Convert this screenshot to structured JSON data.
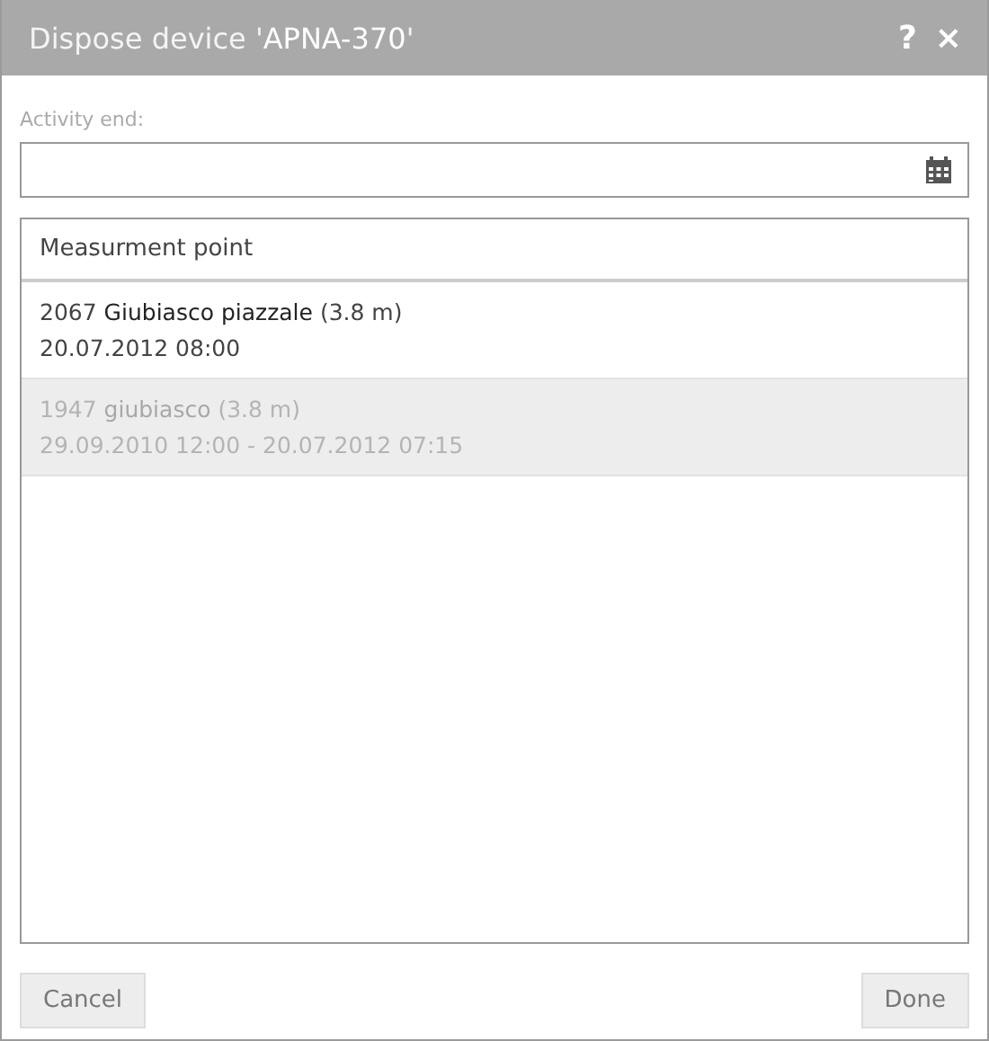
{
  "window": {
    "title": "Dispose device '**APNA-370**'",
    "help": "?",
    "close": "×"
  },
  "activity_end": {
    "label": "Activity end:"
  },
  "list": {
    "header": "Measurment point",
    "rows": [
      {
        "title": "2067 **Giubiasco piazzale** (3.8 m)",
        "date": "20.07.2012 08:00",
        "disabled": false
      },
      {
        "title": "1947 **giubiasco** (3.8 m)",
        "date": "29.09.2010 12:00 - 20.07.2012 07:15",
        "disabled": true
      }
    ]
  },
  "buttons": [
    {
      "label": "Cancel"
    },
    {
      "label": "Done"
    }
  ]
}
